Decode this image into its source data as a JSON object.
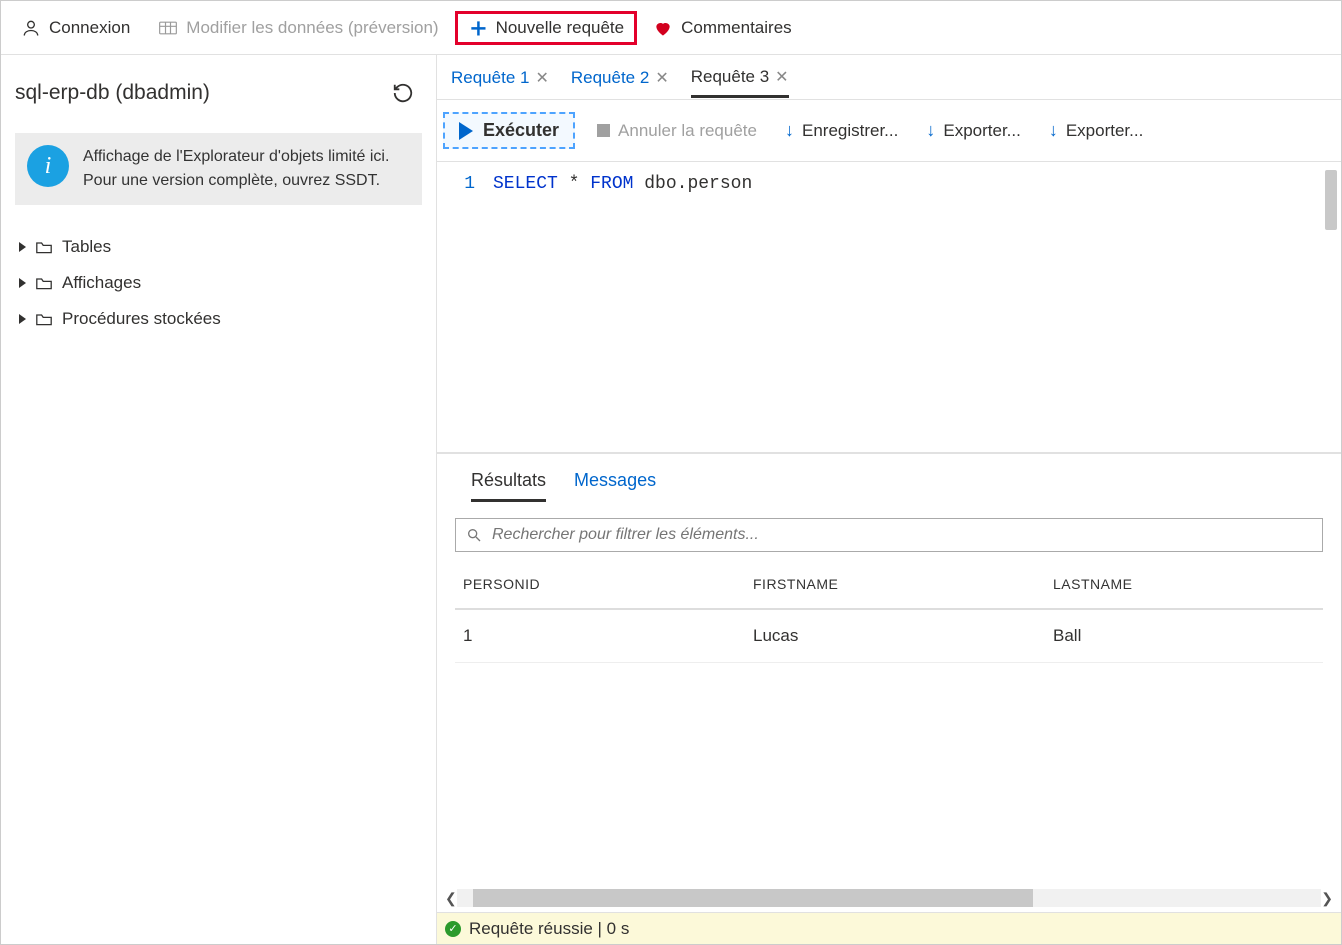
{
  "toolbar": {
    "login": "Connexion",
    "edit_data": "Modifier les données (préversion)",
    "new_query": "Nouvelle requête",
    "feedback": "Commentaires"
  },
  "sidebar": {
    "db_title": "sql-erp-db (dbadmin)",
    "info_text": "Affichage de l'Explorateur d'objets limité ici. Pour une version complète, ouvrez SSDT.",
    "tree": {
      "tables": "Tables",
      "views": "Affichages",
      "procs": "Procédures stockées"
    }
  },
  "query_tabs": {
    "t1": "Requête 1",
    "t2": "Requête 2",
    "t3": "Requête 3"
  },
  "query_toolbar": {
    "execute": "Exécuter",
    "cancel": "Annuler la requête",
    "save": "Enregistrer...",
    "export1": "Exporter...",
    "export2": "Exporter..."
  },
  "editor": {
    "line1_num": "1",
    "kw_select": "SELECT",
    "star": " * ",
    "kw_from": "FROM",
    "rest": " dbo.person"
  },
  "results": {
    "tab_results": "Résultats",
    "tab_messages": "Messages",
    "search_placeholder": "Rechercher pour filtrer les éléments...",
    "columns": {
      "c1": "PERSONID",
      "c2": "FIRSTNAME",
      "c3": "LASTNAME"
    },
    "rows": [
      {
        "c1": "1",
        "c2": "Lucas",
        "c3": "Ball"
      }
    ]
  },
  "status": "Requête réussie | 0 s"
}
